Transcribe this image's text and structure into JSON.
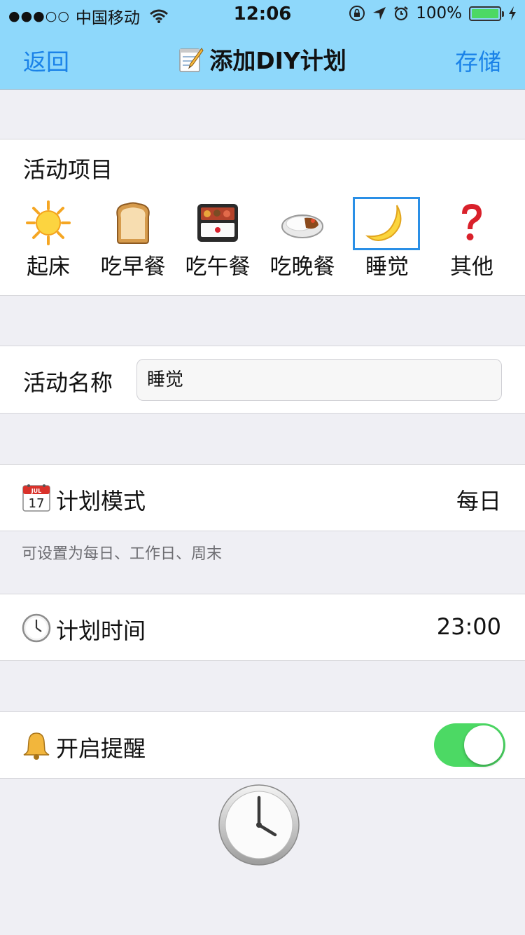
{
  "status_bar": {
    "signal_dots": "●●●○○",
    "carrier": "中国移动",
    "time": "12:06",
    "battery_percent": "100%",
    "battery_level": 1.0,
    "icons": [
      "wifi-icon",
      "rotation-lock-icon",
      "location-arrow-icon",
      "alarm-icon",
      "charging-bolt-icon"
    ]
  },
  "nav": {
    "back_label": "返回",
    "title": "添加DIY计划",
    "title_icon": "memo-icon",
    "save_label": "存储"
  },
  "colors": {
    "nav_background": "#8ed8fb",
    "accent": "#1a82e8",
    "toggle_on": "#4cd964",
    "page_background": "#efeff4"
  },
  "activity": {
    "heading": "活动项目",
    "selected_index": 4,
    "items": [
      {
        "label": "起床",
        "icon": "sun-icon"
      },
      {
        "label": "吃早餐",
        "icon": "bread-icon"
      },
      {
        "label": "吃午餐",
        "icon": "bento-box-icon"
      },
      {
        "label": "吃晚餐",
        "icon": "curry-rice-icon"
      },
      {
        "label": "睡觉",
        "icon": "crescent-moon-icon"
      },
      {
        "label": "其他",
        "icon": "question-mark-icon"
      }
    ]
  },
  "name_row": {
    "label": "活动名称",
    "value": "睡觉"
  },
  "mode_row": {
    "label": "计划模式",
    "icon": "calendar-icon",
    "calendar_month": "JUL",
    "calendar_day": "17",
    "value": "每日",
    "hint": "可设置为每日、工作日、周末"
  },
  "time_row": {
    "label": "计划时间",
    "icon": "clock-icon",
    "value": "23:00"
  },
  "remind_row": {
    "label": "开启提醒",
    "icon": "bell-icon",
    "enabled": true
  },
  "footer": {
    "icon": "clock-icon"
  }
}
